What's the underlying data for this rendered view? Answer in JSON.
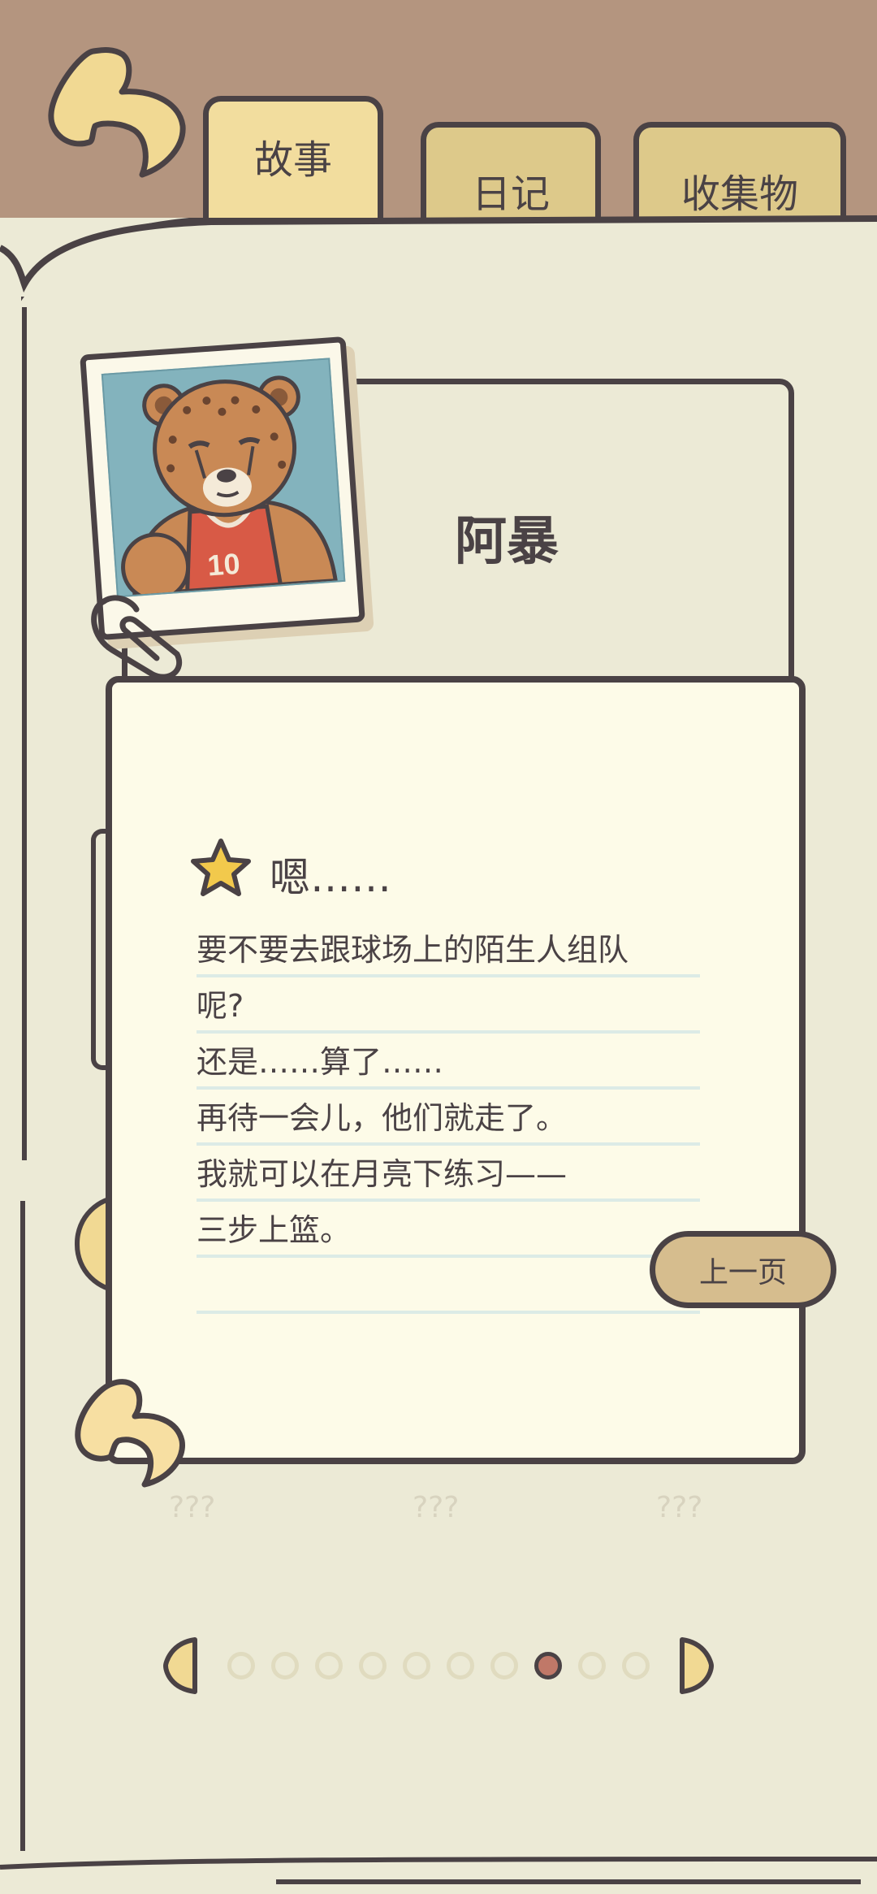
{
  "tabs": [
    {
      "label": "故事",
      "active": true
    },
    {
      "label": "日记",
      "active": false
    },
    {
      "label": "收集物",
      "active": false
    }
  ],
  "character": {
    "name": "阿暴",
    "jersey_number": "10"
  },
  "note": {
    "title": "嗯……",
    "lines": [
      "要不要去跟球场上的陌生人组队",
      "呢?",
      "还是……算了……",
      "再待一会儿，他们就走了。",
      "我就可以在月亮下练习——",
      "三步上篮。"
    ],
    "prev_label": "上一页"
  },
  "locked_items": [
    "???",
    "???",
    "???"
  ],
  "pagination": {
    "total": 10,
    "current": 8
  },
  "colors": {
    "background": "#b4957f",
    "page": "#ecead6",
    "note": "#fdfbe8",
    "outline": "#4a4245",
    "active_tab": "#f2dd9e",
    "tab": "#ddc98a",
    "button": "#d6bd8e",
    "active_dot": "#c07868"
  },
  "icons": {
    "back": "back-arrow-icon",
    "star": "star-icon",
    "prev": "chevron-left-icon",
    "next": "chevron-right-icon"
  }
}
